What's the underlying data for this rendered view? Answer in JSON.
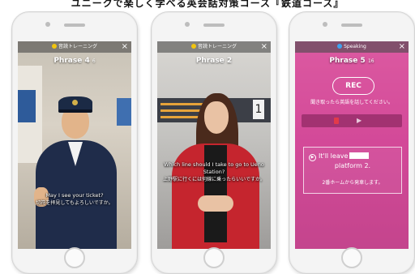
{
  "banner": {
    "text": "ユニークで楽しく学べる英会話対策コース『鉄道コース』"
  },
  "screens": [
    {
      "topbar": "音読トレーニング",
      "phrase_title": "Phrase 4",
      "phrase_suffix": "6",
      "caption_en": "May I see your ticket?",
      "caption_jp": "切符を拝見してもよろしいですか。"
    },
    {
      "topbar": "音読トレーニング",
      "phrase_title": "Phrase 2",
      "phrase_suffix": "",
      "caption_en": "Which line should I take to go to Ueno Station?",
      "caption_jp": "上野駅に行くには何線に乗ったらいいですか。"
    },
    {
      "topbar": "Speaking",
      "phrase_title": "Phrase 5",
      "phrase_suffix": "16",
      "rec_label": "REC",
      "prompt_jp": "聞き取ったら英語を話してください。",
      "card_en_1": "It'll leave",
      "card_en_2": "platform 2.",
      "card_jp": "2番ホームから発車します。"
    }
  ],
  "close_symbol": "×"
}
